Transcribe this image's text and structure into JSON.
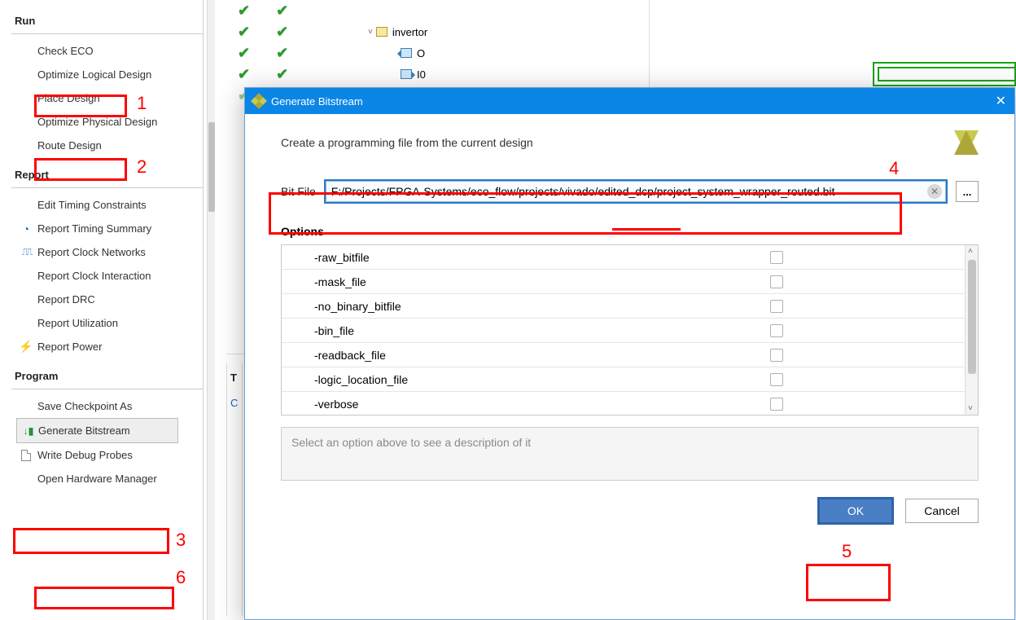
{
  "sidebar": {
    "run": {
      "header": "Run",
      "items": [
        {
          "label": "Check ECO"
        },
        {
          "label": "Optimize Logical Design"
        },
        {
          "label": "Place Design"
        },
        {
          "label": "Optimize Physical Design"
        },
        {
          "label": "Route Design"
        }
      ]
    },
    "report": {
      "header": "Report",
      "items": [
        {
          "label": "Edit Timing Constraints"
        },
        {
          "label": "Report Timing Summary"
        },
        {
          "label": "Report Clock Networks"
        },
        {
          "label": "Report Clock Interaction"
        },
        {
          "label": "Report DRC"
        },
        {
          "label": "Report Utilization"
        },
        {
          "label": "Report Power"
        }
      ]
    },
    "program": {
      "header": "Program",
      "items": [
        {
          "label": "Save Checkpoint As"
        },
        {
          "label": "Generate Bitstream"
        },
        {
          "label": "Write Debug Probes"
        },
        {
          "label": "Open Hardware Manager"
        }
      ]
    }
  },
  "tree": {
    "rows": [
      {
        "label": "invertor"
      },
      {
        "label": "O"
      },
      {
        "label": "I0"
      }
    ]
  },
  "bottom": {
    "t": "T",
    "c": "C"
  },
  "dialog": {
    "title": "Generate Bitstream",
    "desc": "Create a programming file from the current design",
    "bitfile_label": "Bit File",
    "bitfile_value": "F:/Projects/FPGA-Systems/eco_flow/projects/vivado/edited_dcp/project_system_wrapper_routed.bit",
    "options_label": "Options",
    "options": [
      "-raw_bitfile",
      "-mask_file",
      "-no_binary_bitfile",
      "-bin_file",
      "-readback_file",
      "-logic_location_file",
      "-verbose"
    ],
    "desc_placeholder": "Select an option above to see a description of it",
    "ok": "OK",
    "cancel": "Cancel",
    "browse": "..."
  },
  "annotations": {
    "a1": "1",
    "a2": "2",
    "a3": "3",
    "a4": "4",
    "a5": "5",
    "a6": "6"
  }
}
